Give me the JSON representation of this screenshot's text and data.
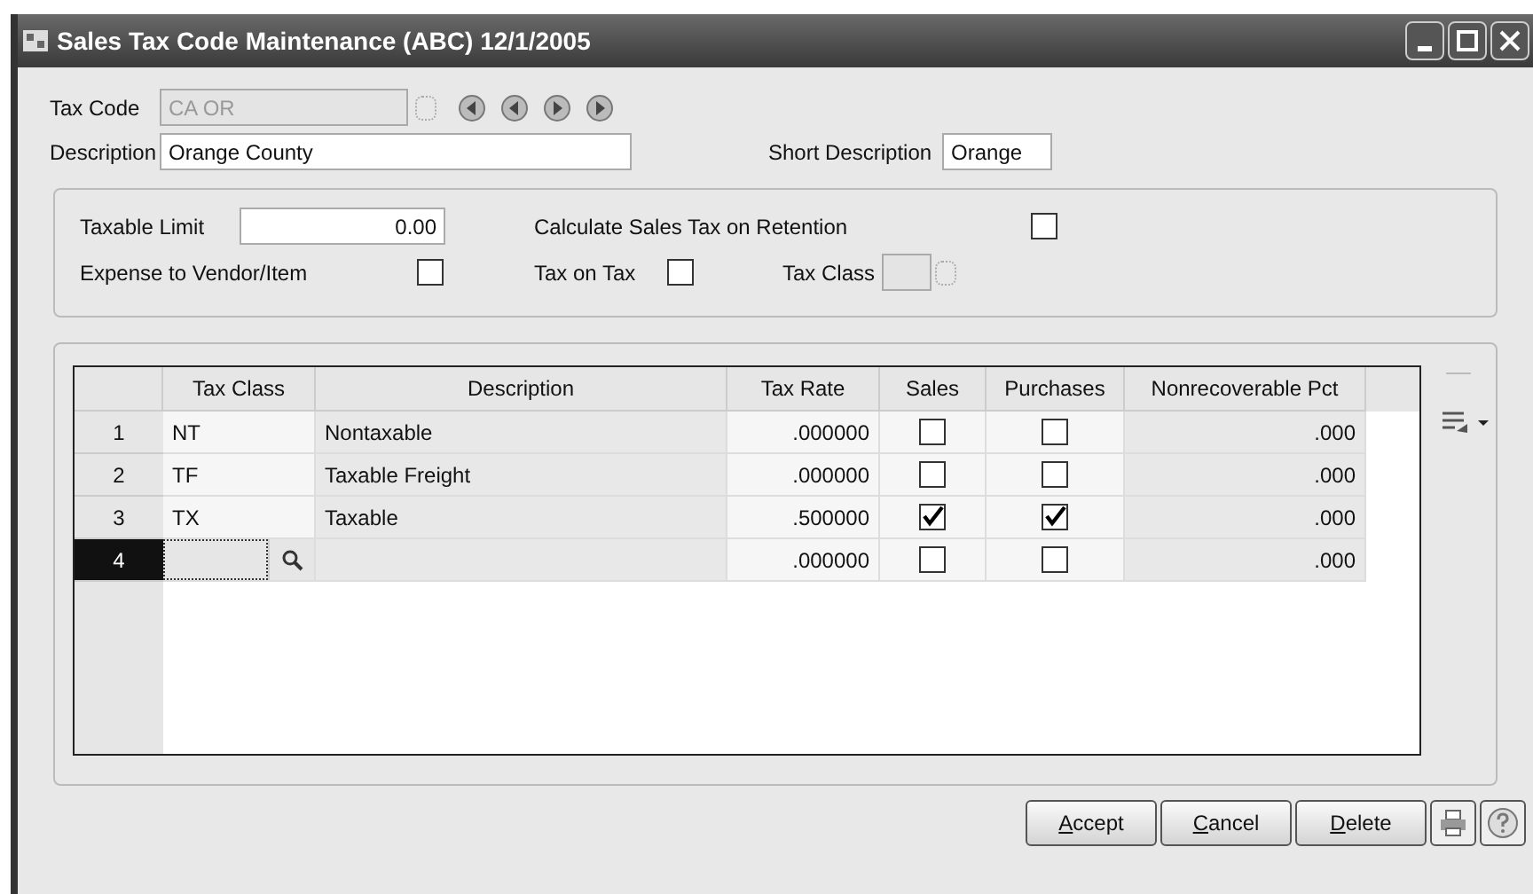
{
  "window": {
    "title": "Sales Tax Code Maintenance (ABC) 12/1/2005"
  },
  "header": {
    "tax_code": {
      "label": "Tax Code",
      "value": "CA OR",
      "disabled": true
    },
    "description": {
      "label": "Description",
      "value": "Orange County"
    },
    "short_description": {
      "label": "Short Description",
      "value": "Orange"
    }
  },
  "options": {
    "taxable_limit": {
      "label": "Taxable Limit",
      "value": "0.00"
    },
    "calc_on_retention": {
      "label": "Calculate Sales Tax on Retention",
      "checked": false
    },
    "expense_to_vendor": {
      "label": "Expense to Vendor/Item",
      "checked": false
    },
    "tax_on_tax": {
      "label": "Tax on Tax",
      "checked": false
    },
    "tax_class": {
      "label": "Tax Class",
      "disabled": true
    }
  },
  "table": {
    "columns": [
      "Tax Class",
      "Description",
      "Tax Rate",
      "Sales",
      "Purchases",
      "Nonrecoverable Pct"
    ],
    "rows": [
      {
        "number": "1",
        "tax_class": "NT",
        "description": "Nontaxable",
        "tax_rate": ".000000",
        "sales": false,
        "purchases": false,
        "nonrecoverable_pct": ".000",
        "selected": false
      },
      {
        "number": "2",
        "tax_class": "TF",
        "description": "Taxable Freight",
        "tax_rate": ".000000",
        "sales": false,
        "purchases": false,
        "nonrecoverable_pct": ".000",
        "selected": false
      },
      {
        "number": "3",
        "tax_class": "TX",
        "description": "Taxable",
        "tax_rate": ".500000",
        "sales": true,
        "purchases": true,
        "nonrecoverable_pct": ".000",
        "selected": false
      },
      {
        "number": "4",
        "tax_class": "",
        "description": "",
        "tax_rate": ".000000",
        "sales": false,
        "purchases": false,
        "nonrecoverable_pct": ".000",
        "selected": true
      }
    ]
  },
  "buttons": [
    "Accept",
    "Cancel",
    "Delete"
  ]
}
